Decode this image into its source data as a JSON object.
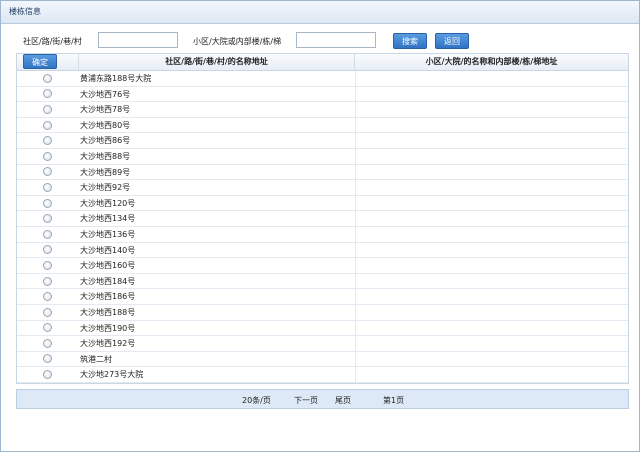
{
  "window": {
    "title": "楼栋信息"
  },
  "search": {
    "label1": "社区/路/街/巷/村",
    "input1_value": "",
    "label2": "小区/大院或内部楼/栋/梯",
    "input2_value": "",
    "search_button": "搜索",
    "back_button": "返回"
  },
  "grid": {
    "confirm_button": "确定",
    "headers": [
      "社区/路/街/巷/村/的名称地址",
      "小区/大院/的名称和内部楼/栋/梯地址"
    ],
    "rows": [
      {
        "addr": "黄浦东路188号大院",
        "sub": ""
      },
      {
        "addr": "大沙地西76号",
        "sub": ""
      },
      {
        "addr": "大沙地西78号",
        "sub": ""
      },
      {
        "addr": "大沙地西80号",
        "sub": ""
      },
      {
        "addr": "大沙地西86号",
        "sub": ""
      },
      {
        "addr": "大沙地西88号",
        "sub": ""
      },
      {
        "addr": "大沙地西89号",
        "sub": ""
      },
      {
        "addr": "大沙地西92号",
        "sub": ""
      },
      {
        "addr": "大沙地西120号",
        "sub": ""
      },
      {
        "addr": "大沙地西134号",
        "sub": ""
      },
      {
        "addr": "大沙地西136号",
        "sub": ""
      },
      {
        "addr": "大沙地西140号",
        "sub": ""
      },
      {
        "addr": "大沙地西160号",
        "sub": ""
      },
      {
        "addr": "大沙地西184号",
        "sub": ""
      },
      {
        "addr": "大沙地西186号",
        "sub": ""
      },
      {
        "addr": "大沙地西188号",
        "sub": ""
      },
      {
        "addr": "大沙地西190号",
        "sub": ""
      },
      {
        "addr": "大沙地西192号",
        "sub": ""
      },
      {
        "addr": "筑港二村",
        "sub": ""
      },
      {
        "addr": "大沙地273号大院",
        "sub": ""
      }
    ]
  },
  "pager": {
    "per_page": "20条/页",
    "next": "下一页",
    "last": "尾页",
    "current": "第1页"
  },
  "colors": {
    "accent": "#2f73c4",
    "header_bg": "#e7eef6",
    "pager_bg": "#dde9f6"
  }
}
